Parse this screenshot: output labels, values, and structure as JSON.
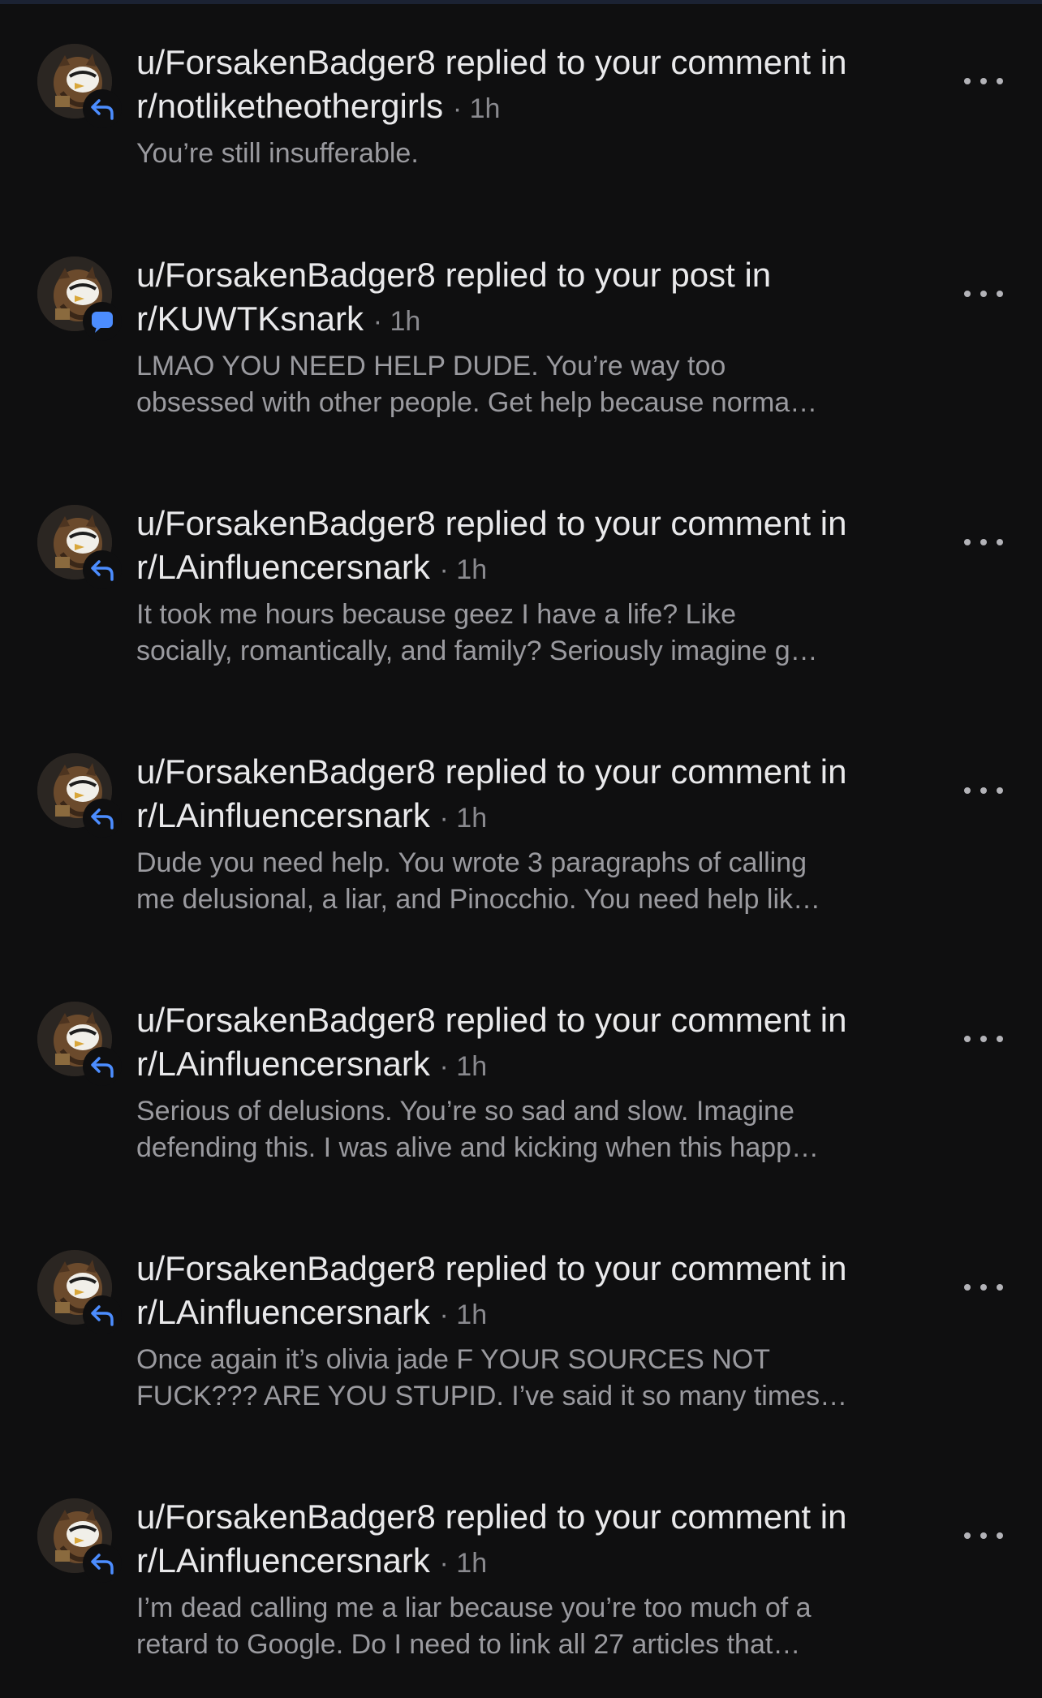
{
  "colors": {
    "background": "#0f0f10",
    "title_text": "#e9e9eb",
    "meta_text": "#8a8a8f",
    "body_text": "#9a9a9f",
    "accent_blue": "#4c8dff"
  },
  "notifications": [
    {
      "title_line1": "u/ForsakenBadger8 replied to your comment in",
      "subreddit": "r/notliketheothergirls",
      "time": "· 1h",
      "preview_line1": "You’re still insufferable.",
      "preview_line2": "",
      "badge_icon": "reply-arrow-icon"
    },
    {
      "title_line1": "u/ForsakenBadger8 replied to your post in",
      "subreddit": "r/KUWTKsnark",
      "time": "· 1h",
      "preview_line1": "LMAO YOU NEED HELP DUDE. You’re way too",
      "preview_line2": "obsessed with other people. Get help because norma…",
      "badge_icon": "chat-bubble-icon"
    },
    {
      "title_line1": "u/ForsakenBadger8 replied to your comment in",
      "subreddit": "r/LAinfluencersnark",
      "time": "· 1h",
      "preview_line1": "It took me hours because geez I have a life? Like",
      "preview_line2": "socially, romantically, and family? Seriously imagine g…",
      "badge_icon": "reply-arrow-icon"
    },
    {
      "title_line1": "u/ForsakenBadger8 replied to your comment in",
      "subreddit": "r/LAinfluencersnark",
      "time": "· 1h",
      "preview_line1": "Dude you need help. You wrote 3 paragraphs of calling",
      "preview_line2": "me delusional, a liar, and Pinocchio. You need help lik…",
      "badge_icon": "reply-arrow-icon"
    },
    {
      "title_line1": "u/ForsakenBadger8 replied to your comment in",
      "subreddit": "r/LAinfluencersnark",
      "time": "· 1h",
      "preview_line1": "Serious of delusions. You’re so sad and slow. Imagine",
      "preview_line2": "defending this. I was alive and kicking when this happ…",
      "badge_icon": "reply-arrow-icon"
    },
    {
      "title_line1": "u/ForsakenBadger8 replied to your comment in",
      "subreddit": "r/LAinfluencersnark",
      "time": "· 1h",
      "preview_line1": "Once again it’s olivia jade F YOUR SOURCES NOT",
      "preview_line2": "FUCK??? ARE YOU STUPID. I’ve said it so many times…",
      "badge_icon": "reply-arrow-icon"
    },
    {
      "title_line1": "u/ForsakenBadger8 replied to your comment in",
      "subreddit": "r/LAinfluencersnark",
      "time": "· 1h",
      "preview_line1": "I’m dead calling me a liar because you’re too much of a",
      "preview_line2": "retard to Google. Do I need to link all 27 articles that…",
      "badge_icon": "reply-arrow-icon"
    }
  ]
}
